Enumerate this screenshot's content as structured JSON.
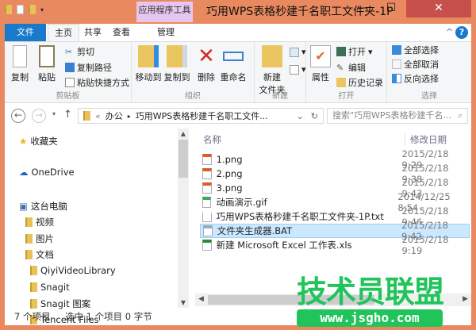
{
  "window": {
    "title": "巧用WPS表格秒建千名职工文件夹-1P",
    "context_tab": "应用程序工具",
    "minimize": "—",
    "maximize": "☐",
    "close": "✕"
  },
  "tabs": [
    {
      "label": "文件"
    },
    {
      "label": "主页"
    },
    {
      "label": "共享"
    },
    {
      "label": "查看"
    },
    {
      "label": "管理"
    }
  ],
  "ribbon": {
    "clipboard": {
      "label": "剪贴板",
      "copy": "复制",
      "paste": "粘贴",
      "cut": "剪切",
      "copy_path": "复制路径",
      "paste_shortcut": "粘贴快捷方式"
    },
    "organize": {
      "label": "组织",
      "move_to": "移动到",
      "copy_to": "复制到",
      "delete": "删除",
      "rename": "重命名"
    },
    "new": {
      "label": "新建",
      "new_folder_line1": "新建",
      "new_folder_line2": "文件夹"
    },
    "open": {
      "label": "打开",
      "properties": "属性",
      "open": "打开",
      "edit": "编辑",
      "history": "历史记录"
    },
    "select": {
      "label": "选择",
      "select_all": "全部选择",
      "select_none": "全部取消",
      "invert": "反向选择"
    }
  },
  "address": {
    "prefix": "«",
    "crumbs": [
      "办公",
      "巧用WPS表格秒建千名职工文件..."
    ],
    "search_placeholder": "搜索\"巧用WPS表格秒建千名..."
  },
  "nav": [
    {
      "label": "收藏夹"
    },
    {
      "label": "OneDrive"
    },
    {
      "label": "这台电脑"
    },
    {
      "label": "视频"
    },
    {
      "label": "图片"
    },
    {
      "label": "文档"
    },
    {
      "label": "QiyiVideoLibrary"
    },
    {
      "label": "Snagit"
    },
    {
      "label": "Snagit 图案"
    },
    {
      "label": "Tencent Files"
    }
  ],
  "columns": {
    "name": "名称",
    "modified": "修改日期"
  },
  "files": [
    {
      "name": "1.png",
      "date": "2015/2/18 9:29",
      "type": "png"
    },
    {
      "name": "2.png",
      "date": "2015/2/18 9:38",
      "type": "png"
    },
    {
      "name": "3.png",
      "date": "2015/2/18 9:43",
      "type": "png"
    },
    {
      "name": "动画演示.gif",
      "date": "2014/12/25 8:54",
      "type": "gif"
    },
    {
      "name": "巧用WPS表格秒建千名职工文件夹-1P.txt",
      "date": "2015/2/18 9:46",
      "type": "txt"
    },
    {
      "name": "文件夹生成器.BAT",
      "date": "2015/2/18 9:42",
      "type": "bat",
      "selected": true
    },
    {
      "name": "新建 Microsoft Excel 工作表.xls",
      "date": "2015/2/18 9:19",
      "type": "xls"
    }
  ],
  "status": {
    "count": "7 个项目",
    "selection": "选中 1 个项目  0 字节"
  },
  "watermark": {
    "brand": "技术员联盟",
    "url": "www.jsgho.com"
  },
  "colors": {
    "frame": "#E9895F",
    "accent": "#1979CA",
    "selection": "#CCE8FF",
    "watermark": "#21C45A"
  }
}
